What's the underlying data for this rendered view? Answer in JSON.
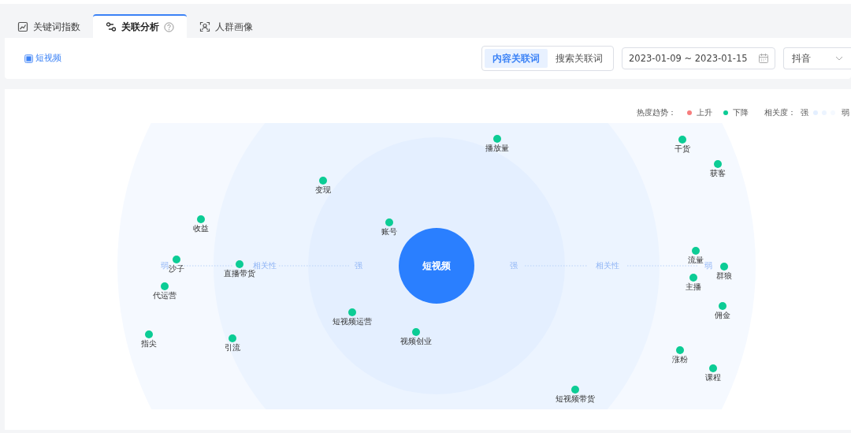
{
  "tabs": [
    {
      "label": "关键词指数",
      "selected": false
    },
    {
      "label": "关联分析",
      "selected": true
    },
    {
      "label": "人群画像",
      "selected": false
    }
  ],
  "keyword_tag": {
    "label": "短视频",
    "checked": true
  },
  "word_type": [
    {
      "label": "内容关联词",
      "selected": true
    },
    {
      "label": "搜索关联词",
      "selected": false
    }
  ],
  "date_range": {
    "value": "2023-01-09 ~ 2023-01-15"
  },
  "platform": {
    "value": "抖音"
  },
  "legend": {
    "trend_title": "热度趋势：",
    "trends": [
      {
        "label": "上升",
        "color": "#f77d7d"
      },
      {
        "label": "下降",
        "color": "#0ccc95"
      }
    ],
    "relevance_title": "相关度：",
    "strong": "强",
    "weak": "弱"
  },
  "center": {
    "label": "短视频"
  },
  "axis": {
    "left": [
      "弱",
      "相关性",
      "强"
    ],
    "right": [
      "强",
      "相关性",
      "弱"
    ]
  },
  "nodes": [
    {
      "label": "播放量",
      "color": "#0ccc95"
    },
    {
      "label": "干货",
      "color": "#0ccc95"
    },
    {
      "label": "获客",
      "color": "#0ccc95"
    },
    {
      "label": "变现",
      "color": "#0ccc95"
    },
    {
      "label": "收益",
      "color": "#0ccc95"
    },
    {
      "label": "账号",
      "color": "#0ccc95"
    },
    {
      "label": "沙子",
      "color": "#0ccc95"
    },
    {
      "label": "直播带货",
      "color": "#0ccc95"
    },
    {
      "label": "流量",
      "color": "#0ccc95"
    },
    {
      "label": "群狼",
      "color": "#0ccc95"
    },
    {
      "label": "主播",
      "color": "#0ccc95"
    },
    {
      "label": "代运营",
      "color": "#0ccc95"
    },
    {
      "label": "佣金",
      "color": "#0ccc95"
    },
    {
      "label": "短视频运营",
      "color": "#0ccc95"
    },
    {
      "label": "视频创业",
      "color": "#0ccc95"
    },
    {
      "label": "指尖",
      "color": "#0ccc95"
    },
    {
      "label": "引流",
      "color": "#0ccc95"
    },
    {
      "label": "涨粉",
      "color": "#0ccc95"
    },
    {
      "label": "课程",
      "color": "#0ccc95"
    },
    {
      "label": "短视频带货",
      "color": "#0ccc95"
    }
  ]
}
